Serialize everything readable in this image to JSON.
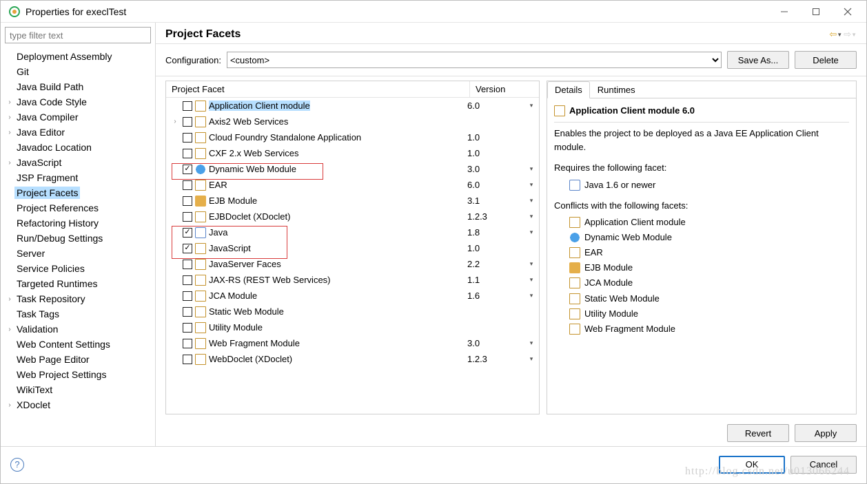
{
  "window": {
    "title": "Properties for execlTest"
  },
  "filter": {
    "placeholder": "type filter text"
  },
  "tree": [
    {
      "label": "Deployment Assembly",
      "expandable": false
    },
    {
      "label": "Git",
      "expandable": false
    },
    {
      "label": "Java Build Path",
      "expandable": false
    },
    {
      "label": "Java Code Style",
      "expandable": true
    },
    {
      "label": "Java Compiler",
      "expandable": true
    },
    {
      "label": "Java Editor",
      "expandable": true
    },
    {
      "label": "Javadoc Location",
      "expandable": false
    },
    {
      "label": "JavaScript",
      "expandable": true
    },
    {
      "label": "JSP Fragment",
      "expandable": false
    },
    {
      "label": "Project Facets",
      "expandable": false,
      "selected": true
    },
    {
      "label": "Project References",
      "expandable": false
    },
    {
      "label": "Refactoring History",
      "expandable": false
    },
    {
      "label": "Run/Debug Settings",
      "expandable": false
    },
    {
      "label": "Server",
      "expandable": false
    },
    {
      "label": "Service Policies",
      "expandable": false
    },
    {
      "label": "Targeted Runtimes",
      "expandable": false
    },
    {
      "label": "Task Repository",
      "expandable": true
    },
    {
      "label": "Task Tags",
      "expandable": false
    },
    {
      "label": "Validation",
      "expandable": true
    },
    {
      "label": "Web Content Settings",
      "expandable": false
    },
    {
      "label": "Web Page Editor",
      "expandable": false
    },
    {
      "label": "Web Project Settings",
      "expandable": false
    },
    {
      "label": "WikiText",
      "expandable": false
    },
    {
      "label": "XDoclet",
      "expandable": true
    }
  ],
  "main": {
    "heading": "Project Facets",
    "config_label": "Configuration:",
    "config_value": "<custom>",
    "save_as": "Save As...",
    "delete": "Delete",
    "col_facet": "Project Facet",
    "col_version": "Version",
    "revert": "Revert",
    "apply": "Apply"
  },
  "facets": [
    {
      "name": "Application Client module",
      "ver": "6.0",
      "dd": true,
      "checked": false,
      "icon": "page",
      "sel": true
    },
    {
      "name": "Axis2 Web Services",
      "ver": "",
      "dd": false,
      "checked": false,
      "icon": "page",
      "expandable": true
    },
    {
      "name": "Cloud Foundry Standalone Application",
      "ver": "1.0",
      "dd": false,
      "checked": false,
      "icon": "page"
    },
    {
      "name": "CXF 2.x Web Services",
      "ver": "1.0",
      "dd": false,
      "checked": false,
      "icon": "page"
    },
    {
      "name": "Dynamic Web Module",
      "ver": "3.0",
      "dd": true,
      "checked": true,
      "icon": "web"
    },
    {
      "name": "EAR",
      "ver": "6.0",
      "dd": true,
      "checked": false,
      "icon": "page"
    },
    {
      "name": "EJB Module",
      "ver": "3.1",
      "dd": true,
      "checked": false,
      "icon": "ejb"
    },
    {
      "name": "EJBDoclet (XDoclet)",
      "ver": "1.2.3",
      "dd": true,
      "checked": false,
      "icon": "page"
    },
    {
      "name": "Java",
      "ver": "1.8",
      "dd": true,
      "checked": true,
      "icon": "java"
    },
    {
      "name": "JavaScript",
      "ver": "1.0",
      "dd": false,
      "checked": true,
      "icon": "page"
    },
    {
      "name": "JavaServer Faces",
      "ver": "2.2",
      "dd": true,
      "checked": false,
      "icon": "page"
    },
    {
      "name": "JAX-RS (REST Web Services)",
      "ver": "1.1",
      "dd": true,
      "checked": false,
      "icon": "page"
    },
    {
      "name": "JCA Module",
      "ver": "1.6",
      "dd": true,
      "checked": false,
      "icon": "page"
    },
    {
      "name": "Static Web Module",
      "ver": "",
      "dd": false,
      "checked": false,
      "icon": "page"
    },
    {
      "name": "Utility Module",
      "ver": "",
      "dd": false,
      "checked": false,
      "icon": "page"
    },
    {
      "name": "Web Fragment Module",
      "ver": "3.0",
      "dd": true,
      "checked": false,
      "icon": "page"
    },
    {
      "name": "WebDoclet (XDoclet)",
      "ver": "1.2.3",
      "dd": true,
      "checked": false,
      "icon": "page"
    }
  ],
  "details": {
    "tab_details": "Details",
    "tab_runtimes": "Runtimes",
    "title": "Application Client module 6.0",
    "desc": "Enables the project to be deployed as a Java EE Application Client module.",
    "req_hdr": "Requires the following facet:",
    "req": [
      {
        "name": "Java 1.6 or newer",
        "icon": "java"
      }
    ],
    "conf_hdr": "Conflicts with the following facets:",
    "conf": [
      {
        "name": "Application Client module",
        "icon": "page"
      },
      {
        "name": "Dynamic Web Module",
        "icon": "web"
      },
      {
        "name": "EAR",
        "icon": "page"
      },
      {
        "name": "EJB Module",
        "icon": "ejb"
      },
      {
        "name": "JCA Module",
        "icon": "page"
      },
      {
        "name": "Static Web Module",
        "icon": "page"
      },
      {
        "name": "Utility Module",
        "icon": "page"
      },
      {
        "name": "Web Fragment Module",
        "icon": "page"
      }
    ]
  },
  "bottom": {
    "ok": "OK",
    "cancel": "Cancel"
  },
  "watermark": "http://blog.csdn.net/u013066244"
}
